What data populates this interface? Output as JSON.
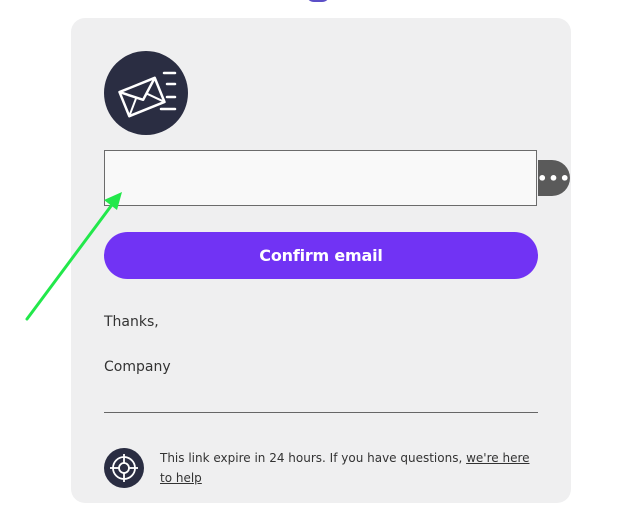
{
  "form": {
    "email_value": "",
    "more_button_label": "•••",
    "confirm_label": "Confirm email"
  },
  "message": {
    "thanks": "Thanks,",
    "company": "Company"
  },
  "footer": {
    "text": "This link expire in 24 hours. If you have questions, ",
    "link_text": "we're here to help"
  },
  "icons": {
    "logo": "email-envelope-icon",
    "footer": "lifebuoy-icon"
  },
  "colors": {
    "accent_button": "#7133f4",
    "icon_background": "#2a2d42",
    "annotation_arrow": "#22e84b"
  }
}
